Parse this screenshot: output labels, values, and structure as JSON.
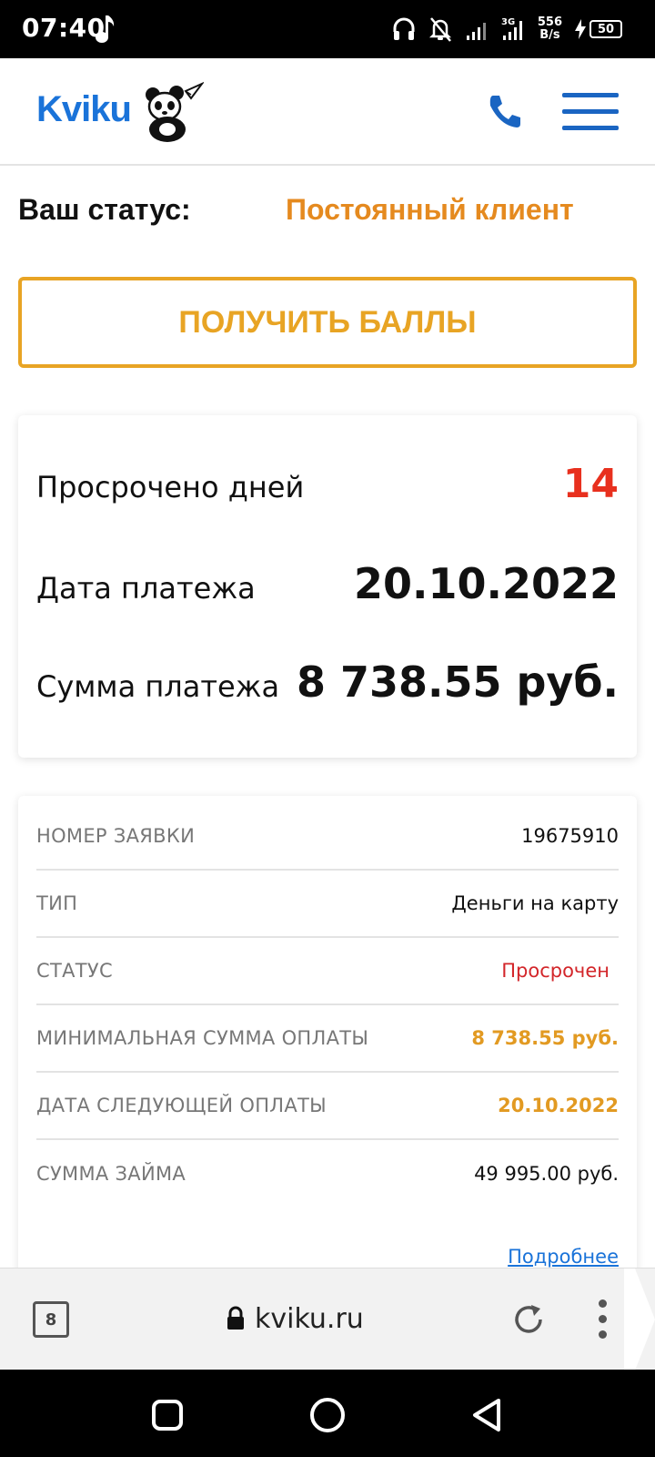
{
  "statusbar": {
    "time": "07:40",
    "net_speed_value": "556",
    "net_speed_unit": "B/s",
    "battery": "50",
    "network": "3G",
    "icons": [
      "music-note-icon",
      "headphones-icon",
      "bell-off-icon",
      "signal-icon",
      "signal-3g-icon",
      "charging-icon",
      "battery-icon"
    ]
  },
  "header": {
    "logo_text": "Kviku",
    "icons": [
      "panda-logo-icon",
      "phone-icon",
      "menu-icon"
    ]
  },
  "status": {
    "label": "Ваш статус:",
    "value": "Постоянный клиент"
  },
  "points_button": {
    "label": "ПОЛУЧИТЬ БАЛЛЫ"
  },
  "summary": {
    "overdue_label": "Просрочено дней",
    "overdue_value": "14",
    "date_label": "Дата платежа",
    "date_value": "20.10.2022",
    "amount_label": "Сумма платежа",
    "amount_value": "8 738.55 руб."
  },
  "details": {
    "rows": [
      {
        "label": "НОМЕР ЗАЯВКИ",
        "value": "19675910"
      },
      {
        "label": "ТИП",
        "value": "Деньги на карту"
      },
      {
        "label": "СТАТУС",
        "value": "Просрочен"
      },
      {
        "label": "МИНИМАЛЬНАЯ СУММА ОПЛАТЫ",
        "value": "8 738.55 руб."
      },
      {
        "label": "ДАТА СЛЕДУЮЩЕЙ ОПЛАТЫ",
        "value": "20.10.2022"
      },
      {
        "label": "СУММА ЗАЙМА",
        "value": "49 995.00 руб."
      }
    ],
    "more_link": "Подробнее"
  },
  "browser": {
    "tab_count": "8",
    "url": "kviku.ru"
  },
  "colors": {
    "brand_blue": "#1a73d9",
    "accent_orange": "#e8a424",
    "status_orange": "#e58a1f",
    "overdue_red": "#e8301e",
    "status_red": "#d3262a"
  }
}
